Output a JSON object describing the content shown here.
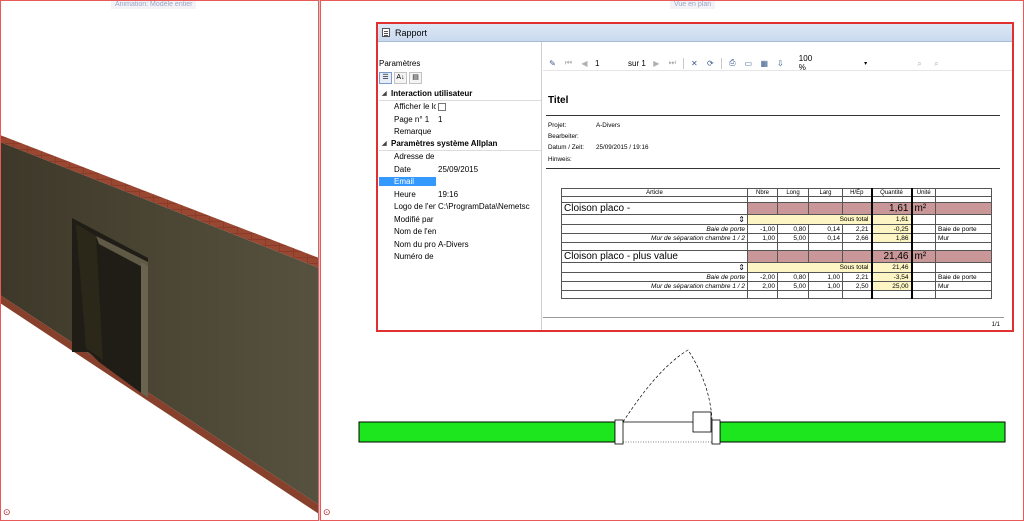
{
  "viewports": {
    "left_title": "Animation: Modèle entier",
    "right_title": "Vue en plan"
  },
  "report": {
    "window_title": "Rapport",
    "params": {
      "title": "Paramètres",
      "categories": [
        {
          "label": "Interaction utilisateur",
          "rows": [
            {
              "name": "Afficher le logo",
              "value": "",
              "checkbox": true
            },
            {
              "name": "Page n° 1",
              "value": "1"
            },
            {
              "name": "Remarque",
              "value": ""
            }
          ]
        },
        {
          "label": "Paramètres système Allplan",
          "rows": [
            {
              "name": "Adresse de l'en",
              "value": ""
            },
            {
              "name": "Date",
              "value": "25/09/2015"
            },
            {
              "name": "Email",
              "value": "",
              "selected": true
            },
            {
              "name": "Heure",
              "value": "19:16"
            },
            {
              "name": "Logo de l'entre",
              "value": "C:\\ProgramData\\Nemetsc"
            },
            {
              "name": "Modifié par",
              "value": ""
            },
            {
              "name": "Nom de l'entrep",
              "value": ""
            },
            {
              "name": "Nom du projet",
              "value": "A-Divers"
            },
            {
              "name": "Numéro de télé",
              "value": ""
            }
          ]
        }
      ]
    },
    "toolbar": {
      "page_current": "1",
      "page_of": "sur 1",
      "zoom": "100 %"
    },
    "page": {
      "title": "Titel",
      "meta": [
        {
          "label": "Projet:",
          "value": "A-Divers"
        },
        {
          "label": "Bearbeiter:",
          "value": ""
        },
        {
          "label": "Datum / Zeit:",
          "value": "25/09/2015  /  19:16"
        },
        {
          "label": "Hinweis:",
          "value": ""
        }
      ],
      "page_number": "1/1"
    },
    "table": {
      "headers": [
        "Article",
        "Nbre",
        "Long",
        "Larg",
        "H/Ép",
        "Quantité",
        "Unité"
      ],
      "groups": [
        {
          "name": "Cloison placo -",
          "quantity": "1,61",
          "unit": "m²",
          "subtotal_label": "Sous total",
          "subtotal": "1,61",
          "stepper": "⇕",
          "rows": [
            {
              "article": "Baie de porte",
              "nbre": "-1,00",
              "long": "0,80",
              "larg": "0,14",
              "h": "2,21",
              "qty": "-0,25",
              "note": "Baie de porte"
            },
            {
              "article": "Mur de séparation chambre 1 / 2",
              "nbre": "1,00",
              "long": "5,00",
              "larg": "0,14",
              "h": "2,66",
              "qty": "1,86",
              "note": "Mur"
            }
          ]
        },
        {
          "name": "Cloison placo - plus value",
          "quantity": "21,46",
          "unit": "m²",
          "subtotal_label": "Sous total",
          "subtotal": "21,46",
          "stepper": "⇕",
          "rows": [
            {
              "article": "Baie de porte",
              "nbre": "-2,00",
              "long": "0,80",
              "larg": "1,00",
              "h": "2,21",
              "qty": "-3,54",
              "note": "Baie de porte"
            },
            {
              "article": "Mur de séparation chambre 1 / 2",
              "nbre": "2,00",
              "long": "5,00",
              "larg": "1,00",
              "h": "2,50",
              "qty": "25,00",
              "note": "Mur"
            }
          ]
        }
      ]
    }
  },
  "colors": {
    "wall_plan": "#1ee61e",
    "wall_3d_face": "#4a4434",
    "wall_3d_brick": "#8c3c2a",
    "group_row": "#c99797",
    "subtotal_fill": "#fdf6c4",
    "window_border": "#e03030"
  }
}
